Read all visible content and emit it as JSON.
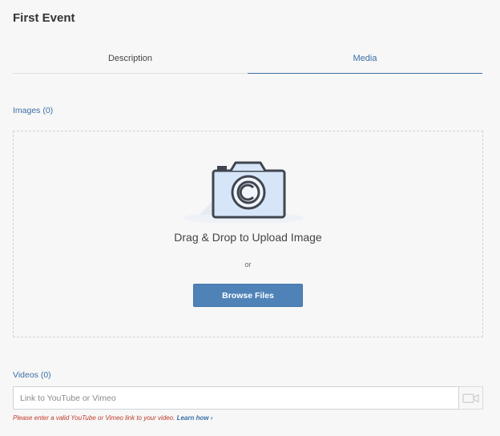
{
  "page": {
    "title": "First Event"
  },
  "tabs": [
    {
      "label": "Description",
      "active": false
    },
    {
      "label": "Media",
      "active": true
    }
  ],
  "images": {
    "label": "Images (0)",
    "icon": "camera-icon",
    "drop_text": "Drag & Drop to Upload Image",
    "or_text": "or",
    "browse_label": "Browse Files"
  },
  "videos": {
    "label": "Videos (0)",
    "placeholder": "Link to YouTube or Vimeo",
    "value": "",
    "icon": "video-camera-icon",
    "hint": "Please enter a valid YouTube or Vimeo link to your video.",
    "learn_more": "Learn how ›"
  },
  "colors": {
    "accent": "#3b6fa6",
    "button": "#4f83b8",
    "error": "#c0392b",
    "background": "#f7f7f7"
  }
}
